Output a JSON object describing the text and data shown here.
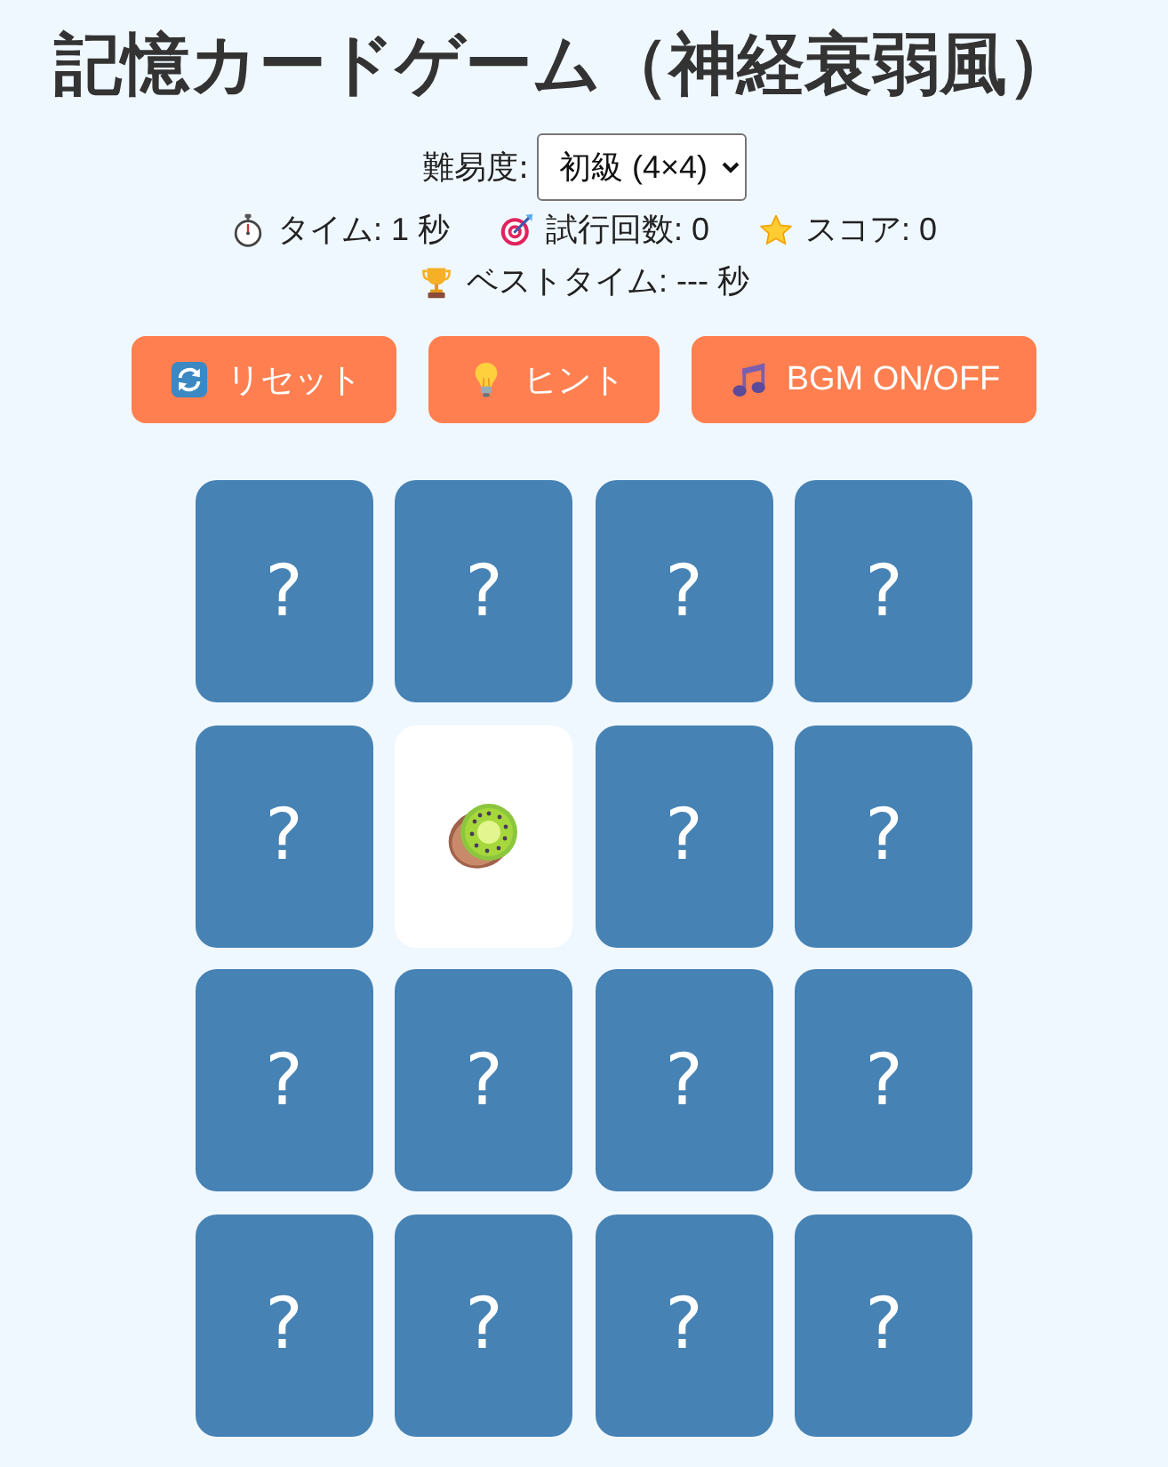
{
  "title": "記憶カードゲーム（神経衰弱風）",
  "difficulty": {
    "label": "難易度:",
    "value": "初級 (4×4)"
  },
  "stats": [
    {
      "kind": "time",
      "label": "タイム: 1 秒"
    },
    {
      "kind": "attempts",
      "label": "試行回数: 0"
    },
    {
      "kind": "score",
      "label": "スコア: 0"
    }
  ],
  "best_time": {
    "kind": "best",
    "label": "ベストタイム: --- 秒"
  },
  "buttons": [
    {
      "kind": "reset",
      "label": "リセット"
    },
    {
      "kind": "hint",
      "label": "ヒント"
    },
    {
      "kind": "bgm",
      "label": "BGM ON/OFF"
    }
  ],
  "cards": [
    {
      "face_up": false,
      "text": "?"
    },
    {
      "face_up": false,
      "text": "?"
    },
    {
      "face_up": false,
      "text": "?"
    },
    {
      "face_up": false,
      "text": "?"
    },
    {
      "face_up": false,
      "text": "?"
    },
    {
      "face_up": true
    },
    {
      "face_up": false,
      "text": "?"
    },
    {
      "face_up": false,
      "text": "?"
    },
    {
      "face_up": false,
      "text": "?"
    },
    {
      "face_up": false,
      "text": "?"
    },
    {
      "face_up": false,
      "text": "?"
    },
    {
      "face_up": false,
      "text": "?"
    },
    {
      "face_up": false,
      "text": "?"
    },
    {
      "face_up": false,
      "text": "?"
    },
    {
      "face_up": false,
      "text": "?"
    },
    {
      "face_up": false,
      "text": "?"
    }
  ]
}
